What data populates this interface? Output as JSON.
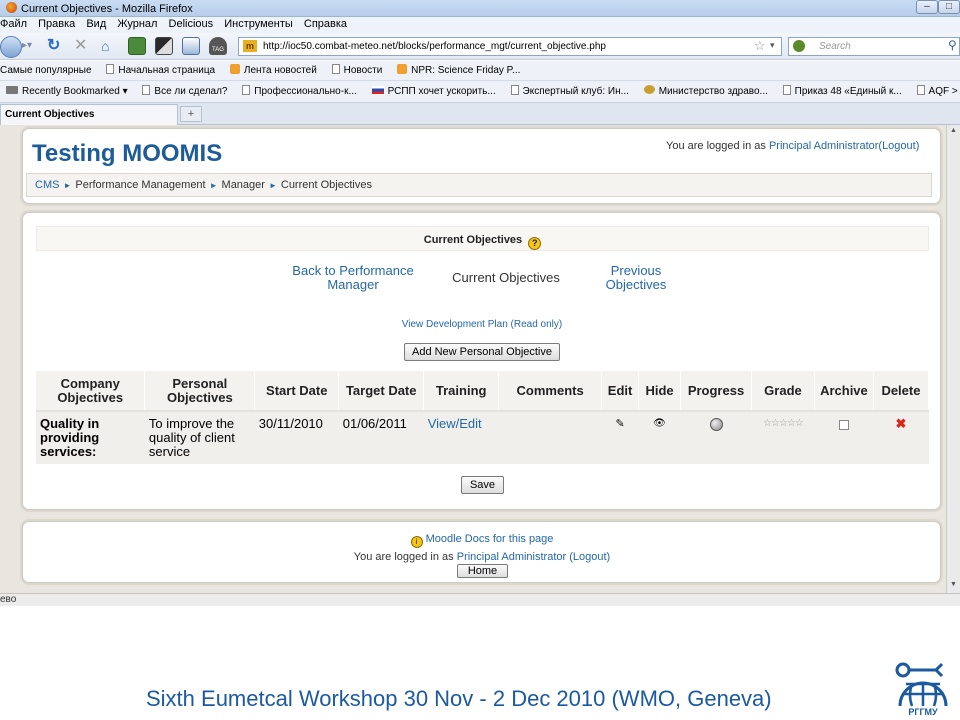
{
  "browser": {
    "window_title": "Current Objectives - Mozilla Firefox",
    "menu": [
      "Файл",
      "Правка",
      "Вид",
      "Журнал",
      "Delicious",
      "Инструменты",
      "Справка"
    ],
    "url": "http://ioc50.combat-meteo.net/blocks/performance_mgt/current_objective.php",
    "search_placeholder": "Search",
    "bookmarks_row1": [
      "Самые популярные",
      "Начальная страница",
      "Лента новостей",
      "Новости",
      "NPR: Science Friday P..."
    ],
    "bookmarks_row2": [
      "Recently Bookmarked",
      "Все ли сделал?",
      "Профессионально-к...",
      "РСПП хочет ускорить...",
      "Экспертный клуб: Ин...",
      "Министерство здраво...",
      "Приказ 48 «Единый к...",
      "AQF > Projects"
    ],
    "tab_label": "Current Objectives",
    "status_text": "ево"
  },
  "page": {
    "site_title": "Testing MOOMIS",
    "login": {
      "prefix": "You are logged in as",
      "user": "Principal Administrator",
      "logout": "(Logout)"
    },
    "breadcrumb": [
      "CMS",
      "Performance Management",
      "Manager",
      "Current Objectives"
    ],
    "section_title": "Current Objectives",
    "nav": {
      "back_line1": "Back to Performance",
      "back_line2": "Manager",
      "current": "Current Objectives",
      "previous_line1": "Previous",
      "previous_line2": "Objectives"
    },
    "dev_plan_link": "View Development Plan (Read only)",
    "add_button": "Add New Personal Objective",
    "table": {
      "headers": [
        "Company Objectives",
        "Personal Objectives",
        "Start Date",
        "Target Date",
        "Training",
        "Comments",
        "Edit",
        "Hide",
        "Progress",
        "Grade",
        "Archive",
        "Delete"
      ],
      "rows": [
        {
          "company": "Quality in providing services:",
          "personal": "To improve the quality of client service",
          "start": "30/11/2010",
          "target": "01/06/2011",
          "training": "View/Edit",
          "comments": ""
        }
      ]
    },
    "save_button": "Save",
    "footer": {
      "docs_link": "Moodle Docs for this page",
      "login_prefix": "You are logged in as",
      "user": "Principal Administrator",
      "logout": "(Logout)",
      "home_button": "Home"
    }
  },
  "slide": {
    "caption": "Sixth Eumetcal Workshop 30 Nov - 2 Dec 2010 (WMO, Geneva)",
    "logo_text": "РГГМУ",
    "colors": {
      "caption": "#1b5aa0",
      "link": "#2468a9",
      "delete": "#d9241a"
    }
  }
}
